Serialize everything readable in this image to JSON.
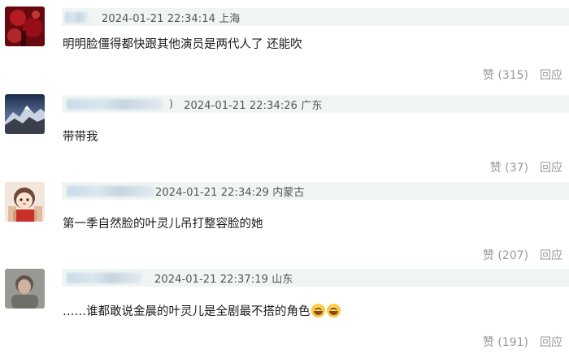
{
  "comments": [
    {
      "timestamp": "2024-01-21 22:34:14 上海",
      "body": "明明脸僵得都快跟其他演员是两代人了 还能吹",
      "like_label": "赞",
      "like_count": "(315)",
      "reply_label": "回应"
    },
    {
      "timestamp": "2024-01-21 22:34:26 广东",
      "paren": ")",
      "body": "带带我",
      "like_label": "赞",
      "like_count": "(37)",
      "reply_label": "回应"
    },
    {
      "timestamp": "2024-01-21 22:34:29 内蒙古",
      "body": "第一季自然脸的叶灵儿吊打整容脸的她",
      "like_label": "赞",
      "like_count": "(207)",
      "reply_label": "回应"
    },
    {
      "timestamp": "2024-01-21 22:37:19 山东",
      "body": "……谁都敢说金晨的叶灵儿是全剧最不搭的角色",
      "emojis": [
        "grinning-sweat-emoji",
        "grinning-sweat-emoji"
      ],
      "like_label": "赞",
      "like_count": "(191)",
      "reply_label": "回应"
    }
  ],
  "colors": {
    "meta_bar": "#eef5f3",
    "action_text": "#999999",
    "body_text": "#1a1a1a"
  }
}
